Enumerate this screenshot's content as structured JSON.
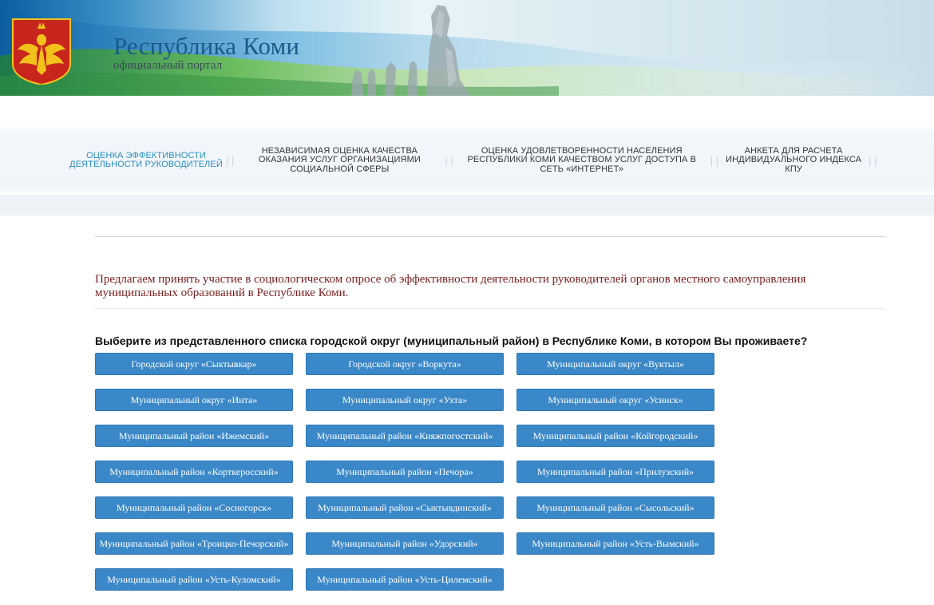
{
  "header": {
    "title": "Республика Коми",
    "subtitle": "официальный портал",
    "colors": {
      "brand_blue": "#1a5a8c",
      "coat_red": "#c8261d",
      "coat_gold": "#f2c21b"
    }
  },
  "nav": {
    "items": [
      {
        "label": "Оценка эффективности деятельности руководителей",
        "active": true
      },
      {
        "label": "Независимая оценка качества оказания услуг организациями социальной сферы",
        "active": false
      },
      {
        "label": "Оценка удовлетворенности населения Республики Коми качеством услуг доступа в сеть «Интернет»",
        "active": false
      },
      {
        "label": "Анкета для расчета индивидуального индекса КПУ",
        "active": false
      }
    ],
    "separator": "| |",
    "active_color": "#2a8fc0"
  },
  "content": {
    "intro": "Предлагаем принять участие в социологическом опросе об эффективности деятельности руководителей органов местного самоуправления муниципальных образований в Республике Коми.",
    "question": "Выберите из представленного списка городской округ (муниципальный район) в Республике Коми, в котором Вы проживаете?",
    "button_color": "#3b88c9",
    "districts": [
      "Городской округ «Сыктывкар»",
      "Городской округ «Воркута»",
      "Муниципальный округ «Вуктыл»",
      "Муниципальный округ «Инта»",
      "Муниципальный округ «Ухта»",
      "Муниципальный округ «Усинск»",
      "Муниципальный район «Ижемский»",
      "Муниципальный район «Княжпогостский»",
      "Муниципальный район «Койгородский»",
      "Муниципальный район «Корткеросский»",
      "Муниципальный район «Печора»",
      "Муниципальный район «Прилузский»",
      "Муниципальный район «Сосногорск»",
      "Муниципальный район «Сыктывдинский»",
      "Муниципальный район «Сысольский»",
      "Муниципальный район «Троицко-Печорский»",
      "Муниципальный район «Удорский»",
      "Муниципальный район «Усть-Вымский»",
      "Муниципальный район «Усть-Куломский»",
      "Муниципальный район «Усть-Цилемский»"
    ]
  }
}
